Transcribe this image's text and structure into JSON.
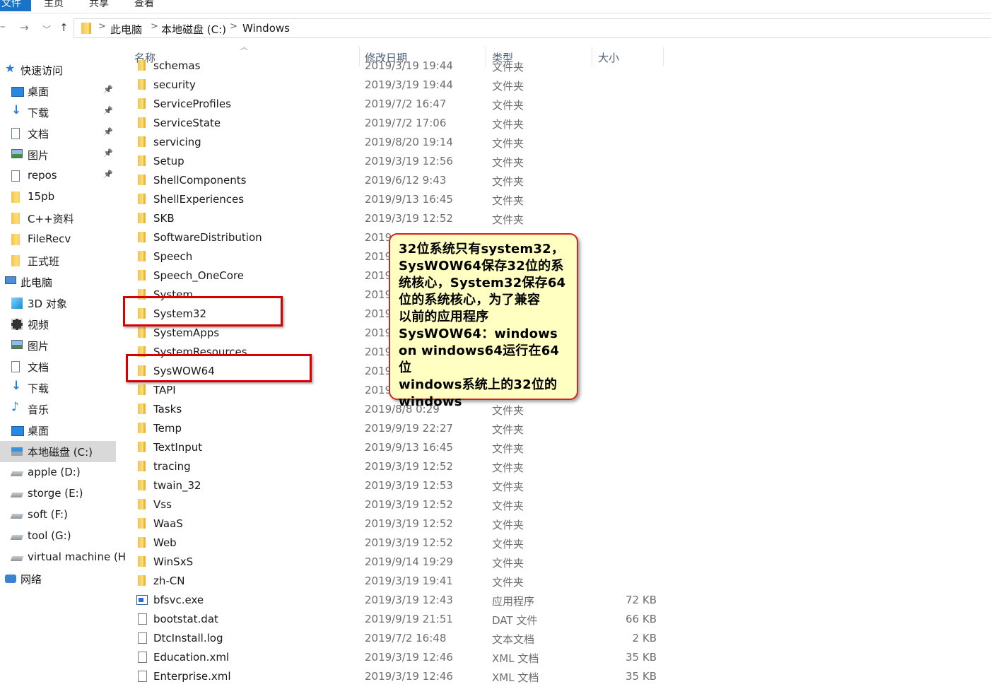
{
  "ribbon": {
    "tabs": [
      "文件",
      "主页",
      "共享",
      "查看"
    ]
  },
  "address": {
    "crumbs": [
      "此电脑",
      "本地磁盘 (C:)",
      "Windows"
    ]
  },
  "sidebar": {
    "items": [
      {
        "label": "快速访问",
        "icon": "star-icon"
      },
      {
        "label": "桌面",
        "icon": "desktop-icon"
      },
      {
        "label": "下载",
        "icon": "download-icon"
      },
      {
        "label": "文档",
        "icon": "document-icon"
      },
      {
        "label": "图片",
        "icon": "picture-icon"
      },
      {
        "label": "repos",
        "icon": "document-icon"
      },
      {
        "label": "15pb",
        "icon": "folder-icon"
      },
      {
        "label": "C++资料",
        "icon": "folder-icon"
      },
      {
        "label": "FileRecv",
        "icon": "folder-icon"
      },
      {
        "label": "正式班",
        "icon": "folder-icon"
      },
      {
        "label": "此电脑",
        "icon": "computer-icon"
      },
      {
        "label": "3D 对象",
        "icon": "cube-icon"
      },
      {
        "label": "视频",
        "icon": "video-icon"
      },
      {
        "label": "图片",
        "icon": "picture-icon"
      },
      {
        "label": "文档",
        "icon": "document-icon"
      },
      {
        "label": "下载",
        "icon": "download-icon"
      },
      {
        "label": "音乐",
        "icon": "music-icon"
      },
      {
        "label": "桌面",
        "icon": "desktop-icon"
      },
      {
        "label": "本地磁盘 (C:)",
        "icon": "windows-drive-icon"
      },
      {
        "label": "apple (D:)",
        "icon": "drive-icon"
      },
      {
        "label": "storge (E:)",
        "icon": "drive-icon"
      },
      {
        "label": "soft (F:)",
        "icon": "drive-icon"
      },
      {
        "label": "tool (G:)",
        "icon": "drive-icon"
      },
      {
        "label": "virtual machine (H",
        "icon": "drive-icon"
      },
      {
        "label": "网络",
        "icon": "network-icon"
      }
    ]
  },
  "columns": {
    "name": "名称",
    "date": "修改日期",
    "type": "类型",
    "size": "大小"
  },
  "files": [
    {
      "name": "schemas",
      "date": "2019/3/19 19:44",
      "type": "文件夹",
      "size": "",
      "kind": "folder"
    },
    {
      "name": "security",
      "date": "2019/3/19 19:44",
      "type": "文件夹",
      "size": "",
      "kind": "folder"
    },
    {
      "name": "ServiceProfiles",
      "date": "2019/7/2 16:47",
      "type": "文件夹",
      "size": "",
      "kind": "folder"
    },
    {
      "name": "ServiceState",
      "date": "2019/7/2 17:06",
      "type": "文件夹",
      "size": "",
      "kind": "folder"
    },
    {
      "name": "servicing",
      "date": "2019/8/20 19:14",
      "type": "文件夹",
      "size": "",
      "kind": "folder"
    },
    {
      "name": "Setup",
      "date": "2019/3/19 12:56",
      "type": "文件夹",
      "size": "",
      "kind": "folder"
    },
    {
      "name": "ShellComponents",
      "date": "2019/6/12 9:43",
      "type": "文件夹",
      "size": "",
      "kind": "folder"
    },
    {
      "name": "ShellExperiences",
      "date": "2019/9/13 16:45",
      "type": "文件夹",
      "size": "",
      "kind": "folder"
    },
    {
      "name": "SKB",
      "date": "2019/3/19 12:52",
      "type": "文件夹",
      "size": "",
      "kind": "folder"
    },
    {
      "name": "SoftwareDistribution",
      "date": "2019",
      "type": "",
      "size": "",
      "kind": "folder"
    },
    {
      "name": "Speech",
      "date": "2019",
      "type": "",
      "size": "",
      "kind": "folder"
    },
    {
      "name": "Speech_OneCore",
      "date": "2019",
      "type": "",
      "size": "",
      "kind": "folder"
    },
    {
      "name": "System",
      "date": "2019",
      "type": "",
      "size": "",
      "kind": "folder"
    },
    {
      "name": "System32",
      "date": "2019",
      "type": "",
      "size": "",
      "kind": "folder"
    },
    {
      "name": "SystemApps",
      "date": "2019",
      "type": "",
      "size": "",
      "kind": "folder"
    },
    {
      "name": "SystemResources",
      "date": "2019",
      "type": "",
      "size": "",
      "kind": "folder"
    },
    {
      "name": "SysWOW64",
      "date": "2019",
      "type": "",
      "size": "",
      "kind": "folder"
    },
    {
      "name": "TAPI",
      "date": "2019",
      "type": "",
      "size": "",
      "kind": "folder"
    },
    {
      "name": "Tasks",
      "date": "2019/8/8 0:29",
      "type": "文件夹",
      "size": "",
      "kind": "folder"
    },
    {
      "name": "Temp",
      "date": "2019/9/19 22:27",
      "type": "文件夹",
      "size": "",
      "kind": "folder"
    },
    {
      "name": "TextInput",
      "date": "2019/9/13 16:45",
      "type": "文件夹",
      "size": "",
      "kind": "folder"
    },
    {
      "name": "tracing",
      "date": "2019/3/19 12:52",
      "type": "文件夹",
      "size": "",
      "kind": "folder"
    },
    {
      "name": "twain_32",
      "date": "2019/3/19 12:53",
      "type": "文件夹",
      "size": "",
      "kind": "folder"
    },
    {
      "name": "Vss",
      "date": "2019/3/19 12:52",
      "type": "文件夹",
      "size": "",
      "kind": "folder"
    },
    {
      "name": "WaaS",
      "date": "2019/3/19 12:52",
      "type": "文件夹",
      "size": "",
      "kind": "folder"
    },
    {
      "name": "Web",
      "date": "2019/3/19 12:52",
      "type": "文件夹",
      "size": "",
      "kind": "folder"
    },
    {
      "name": "WinSxS",
      "date": "2019/9/14 19:29",
      "type": "文件夹",
      "size": "",
      "kind": "folder"
    },
    {
      "name": "zh-CN",
      "date": "2019/3/19 19:41",
      "type": "文件夹",
      "size": "",
      "kind": "folder"
    },
    {
      "name": "bfsvc.exe",
      "date": "2019/3/19 12:43",
      "type": "应用程序",
      "size": "72 KB",
      "kind": "exe"
    },
    {
      "name": "bootstat.dat",
      "date": "2019/9/19 21:51",
      "type": "DAT 文件",
      "size": "66 KB",
      "kind": "file"
    },
    {
      "name": "DtcInstall.log",
      "date": "2019/7/2 16:48",
      "type": "文本文档",
      "size": "2 KB",
      "kind": "file"
    },
    {
      "name": "Education.xml",
      "date": "2019/3/19 12:46",
      "type": "XML 文档",
      "size": "35 KB",
      "kind": "file"
    },
    {
      "name": "Enterprise.xml",
      "date": "2019/3/19 12:46",
      "type": "XML 文档",
      "size": "35 KB",
      "kind": "file"
    }
  ],
  "callout": {
    "lines": [
      "32位系统只有system32，",
      "SysWOW64保存32位的系",
      "统核心，System32保存64",
      "位的系统核心，为了兼容",
      "以前的应用程序",
      "SysWOW64：windows",
      "on windows64运行在64位",
      "windows系统上的32位的",
      "windows"
    ]
  },
  "colors": {
    "highlight": "#d60000",
    "callout_bg": "#ffffc2",
    "selected_bg": "#d9d9d9",
    "accent": "#1a73c7"
  }
}
